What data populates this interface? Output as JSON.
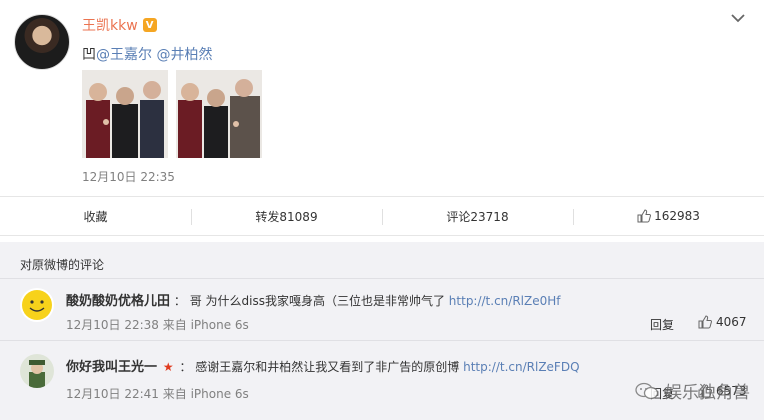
{
  "post": {
    "username": "王凯kkw",
    "verified_badge": "V",
    "text_prefix": "凹",
    "mentions": [
      "@王嘉尔",
      "@井柏然"
    ],
    "time": "12月10日 22:35"
  },
  "actions": {
    "favorite": "收藏",
    "repost": "转发81089",
    "comment": "评论23718",
    "like": "162983"
  },
  "comments": {
    "title": "对原微博的评论",
    "items": [
      {
        "user": "酸奶酸奶优格儿田",
        "separator": "：",
        "text": "哥 为什么diss我家嘎身高（三位也是非常帅气了",
        "link": "http://t.cn/RlZe0Hf",
        "meta": "12月10日 22:38 来自 iPhone 6s",
        "reply": "回复",
        "likes": "4067"
      },
      {
        "user": "你好我叫王光一",
        "separator": "：",
        "text": "感谢王嘉尔和井柏然让我又看到了非广告的原创博",
        "link": "http://t.cn/RlZeFDQ",
        "meta": "12月10日 22:41 来自 iPhone 6s",
        "reply": "回复",
        "likes": "6573"
      }
    ]
  },
  "watermark": "娱乐独角兽",
  "colors": {
    "username": "#eb7350",
    "link": "#5a7fb5",
    "badge": "#f5a623",
    "meta": "#808080"
  }
}
